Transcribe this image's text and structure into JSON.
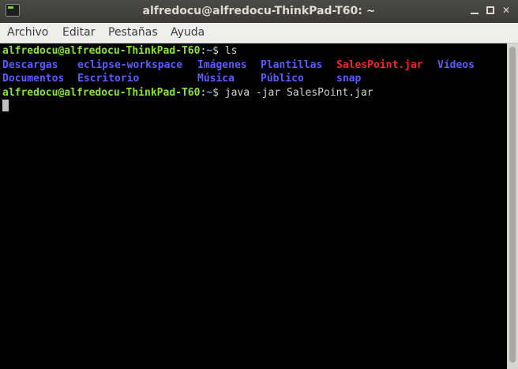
{
  "window": {
    "title": "alfredocu@alfredocu-ThinkPad-T60: ~",
    "controls": {
      "minimize_icon": "minimize-icon",
      "maximize_icon": "maximize-icon",
      "close_label": "✕"
    }
  },
  "menu": {
    "items": [
      {
        "label": "Archivo"
      },
      {
        "label": "Editar"
      },
      {
        "label": "Pestañas"
      },
      {
        "label": "Ayuda"
      }
    ]
  },
  "terminal": {
    "prompt_user": "alfredocu@alfredocu-ThinkPad-T60",
    "prompt_sep": ":",
    "prompt_path": "~",
    "prompt_symbol": "$",
    "command1": " ls",
    "command2": " java -jar SalesPoint.jar",
    "ls_row1": [
      "Descargas",
      "eclipse-workspace",
      "Imágenes",
      "Plantillas",
      "SalesPoint.jar",
      "Vídeos"
    ],
    "ls_row2": [
      "Documentos",
      "Escritorio",
      "Música",
      "Público",
      "snap"
    ]
  },
  "colors": {
    "prompt": "#8ae234",
    "path": "#729fcf",
    "directory": "#5c5cff",
    "jar": "#ef2929",
    "background": "#000000"
  }
}
